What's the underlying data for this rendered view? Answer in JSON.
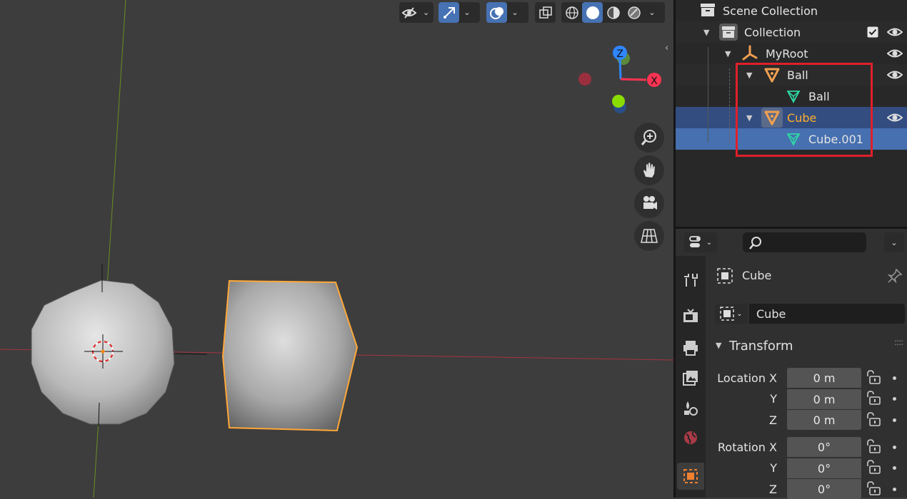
{
  "viewport": {
    "gizmo": {
      "z_label": "Z",
      "x_label": "X"
    },
    "header_icons": [
      "visibility-icon",
      "gizmo-icon",
      "overlay-icon",
      "xray-icon",
      "wireframe-shading-icon",
      "solid-shading-icon",
      "material-shading-icon",
      "rendered-shading-icon"
    ],
    "nav_icons": [
      "zoom-icon",
      "hand-pan-icon",
      "camera-icon",
      "grid-perspective-icon"
    ]
  },
  "outliner": {
    "rows": [
      {
        "label": "Scene Collection",
        "icon": "scene-collection-icon"
      },
      {
        "label": "Collection",
        "icon": "collection-icon",
        "checked": true
      },
      {
        "label": "MyRoot",
        "icon": "empty-axes-icon"
      },
      {
        "label": "Ball",
        "icon": "object-mesh-icon"
      },
      {
        "label": "Ball",
        "icon": "mesh-data-icon"
      },
      {
        "label": "Cube",
        "icon": "object-mesh-icon",
        "active": true
      },
      {
        "label": "Cube.001",
        "icon": "mesh-data-icon",
        "selected": true
      }
    ],
    "highlight_color": "#e0202a"
  },
  "properties": {
    "search_placeholder": "",
    "object_title": "Cube",
    "name_field": "Cube",
    "section_label": "Transform",
    "location": {
      "label": "Location X",
      "y_label": "Y",
      "z_label": "Z",
      "x": "0 m",
      "y": "0 m",
      "z": "0 m"
    },
    "rotation": {
      "label": "Rotation X",
      "y_label": "Y",
      "z_label": "Z",
      "x": "0°",
      "y": "0°",
      "z": "0°"
    },
    "tab_icons": [
      "tool-icon",
      "render-icon",
      "output-icon",
      "view-layer-icon",
      "scene-icon",
      "world-icon",
      "object-icon"
    ]
  },
  "colors": {
    "accent": "#4772b3",
    "selected_orange": "#ffa838",
    "axis_x": "#ff3352",
    "axis_y": "#8bdc00",
    "axis_z": "#2f86ff"
  }
}
